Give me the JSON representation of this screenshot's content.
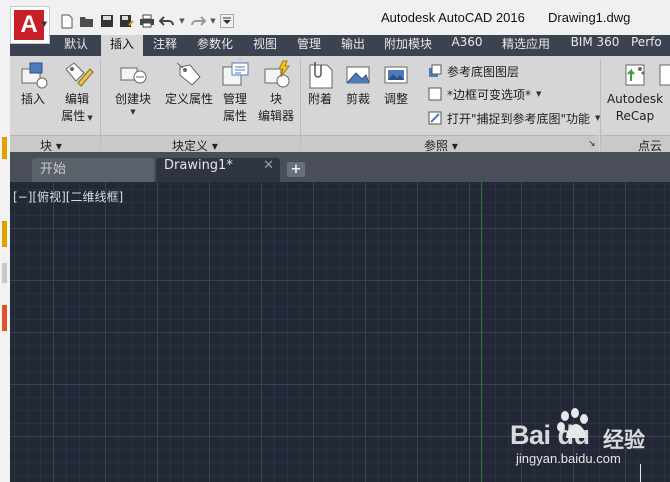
{
  "window": {
    "app_title": "Autodesk AutoCAD 2016",
    "document_title": "Drawing1.dwg"
  },
  "app_button": {
    "logo_letter": "A",
    "icon": "autocad-logo-icon"
  },
  "quick_access": [
    {
      "icon": "new-file-icon"
    },
    {
      "icon": "open-folder-icon"
    },
    {
      "icon": "save-icon"
    },
    {
      "icon": "save-as-icon"
    },
    {
      "icon": "print-icon"
    },
    {
      "icon": "undo-icon"
    },
    {
      "icon": "redo-icon"
    },
    {
      "icon": "customize-dropdown-icon"
    }
  ],
  "ribbon_tabs": [
    {
      "label": "默认"
    },
    {
      "label": "插入",
      "active": true
    },
    {
      "label": "注释"
    },
    {
      "label": "参数化"
    },
    {
      "label": "视图"
    },
    {
      "label": "管理"
    },
    {
      "label": "输出"
    },
    {
      "label": "附加模块"
    },
    {
      "label": "A360"
    },
    {
      "label": "精选应用"
    },
    {
      "label": "BIM 360"
    },
    {
      "label": "Perfo"
    }
  ],
  "ribbon": {
    "groups": {
      "block": "块",
      "block_definition": "块定义",
      "reference": "参照",
      "point_cloud": "点云"
    },
    "buttons": {
      "insert": "插入",
      "edit_attr_1": "编辑",
      "edit_attr_2": "属性",
      "create_block": "创建块",
      "define_attr": "定义属性",
      "manage_attr_1": "管理",
      "manage_attr_2": "属性",
      "block_editor_1": "块",
      "block_editor_2": "编辑器",
      "attach": "附着",
      "clip": "剪裁",
      "adjust": "调整",
      "recap_1": "Autodesk",
      "recap_2": "ReCap"
    },
    "small_buttons": {
      "underlay_layers": "参考底图图层",
      "frames_vary": "*边框可变选项*",
      "snap_underlays": "打开\"捕捉到参考底图\"功能"
    }
  },
  "file_tabs": {
    "start": "开始",
    "drawing": "Drawing1*",
    "close": "✕",
    "new": "+"
  },
  "canvas": {
    "viewport_label": "[−][俯视][二维线框]",
    "background": "#232836"
  },
  "watermark": {
    "logo": "Bai du",
    "text": "经验",
    "url": "jingyan.baidu.com"
  }
}
